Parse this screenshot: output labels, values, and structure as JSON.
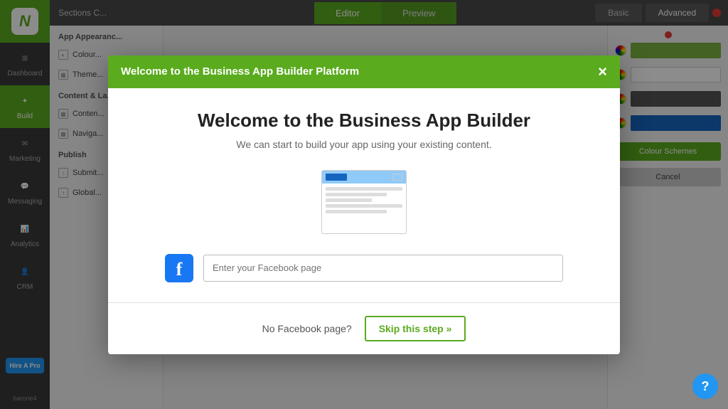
{
  "sidebar": {
    "logo": "N",
    "items": [
      {
        "id": "dashboard",
        "label": "Dashboard",
        "icon": "⊞"
      },
      {
        "id": "build",
        "label": "Build",
        "icon": "✦",
        "active": true
      },
      {
        "id": "marketing",
        "label": "Marketing",
        "icon": "✉"
      },
      {
        "id": "messaging",
        "label": "Messaging",
        "icon": "💬"
      },
      {
        "id": "analytics",
        "label": "Analytics",
        "icon": "📊"
      },
      {
        "id": "crm",
        "label": "CRM",
        "icon": "👤"
      }
    ],
    "hire_btn": "Hire A Pro",
    "user_label": "barone4"
  },
  "topbar": {
    "sections_label": "Sections C...",
    "tabs": [
      {
        "id": "editor",
        "label": "Editor",
        "active": true
      },
      {
        "id": "preview",
        "label": "Preview"
      }
    ],
    "mode_tabs": [
      {
        "id": "basic",
        "label": "Basic"
      },
      {
        "id": "advanced",
        "label": "Advanced",
        "active": true
      }
    ]
  },
  "left_panel": {
    "app_appearance_title": "App Appearanc...",
    "items": [
      {
        "id": "colour",
        "label": "Colour..."
      },
      {
        "id": "theme",
        "label": "Theme..."
      }
    ],
    "content_title": "Content & La...",
    "content_items": [
      {
        "id": "content",
        "label": "Conten..."
      },
      {
        "id": "navigation",
        "label": "Naviga..."
      }
    ],
    "publish_title": "Publish",
    "publish_items": [
      {
        "id": "submit",
        "label": "Submit..."
      },
      {
        "id": "global",
        "label": "Global..."
      }
    ]
  },
  "right_panel": {
    "color_rows": [
      {
        "color": "#7CB342"
      },
      {
        "color": "#ffffff"
      },
      {
        "color": "#555555"
      },
      {
        "color": "#1565C0"
      }
    ],
    "colour_schemes_label": "Colour Schemes",
    "cancel_label": "Cancel"
  },
  "modal": {
    "header_title": "Welcome to the Business App Builder Platform",
    "close_icon": "×",
    "title": "Welcome to the Business App Builder",
    "subtitle": "We can start to build your app using your existing content.",
    "facebook_placeholder": "Enter your Facebook page",
    "no_facebook_label": "No Facebook page?",
    "skip_label": "Skip this step »"
  },
  "help": {
    "label": "?"
  }
}
